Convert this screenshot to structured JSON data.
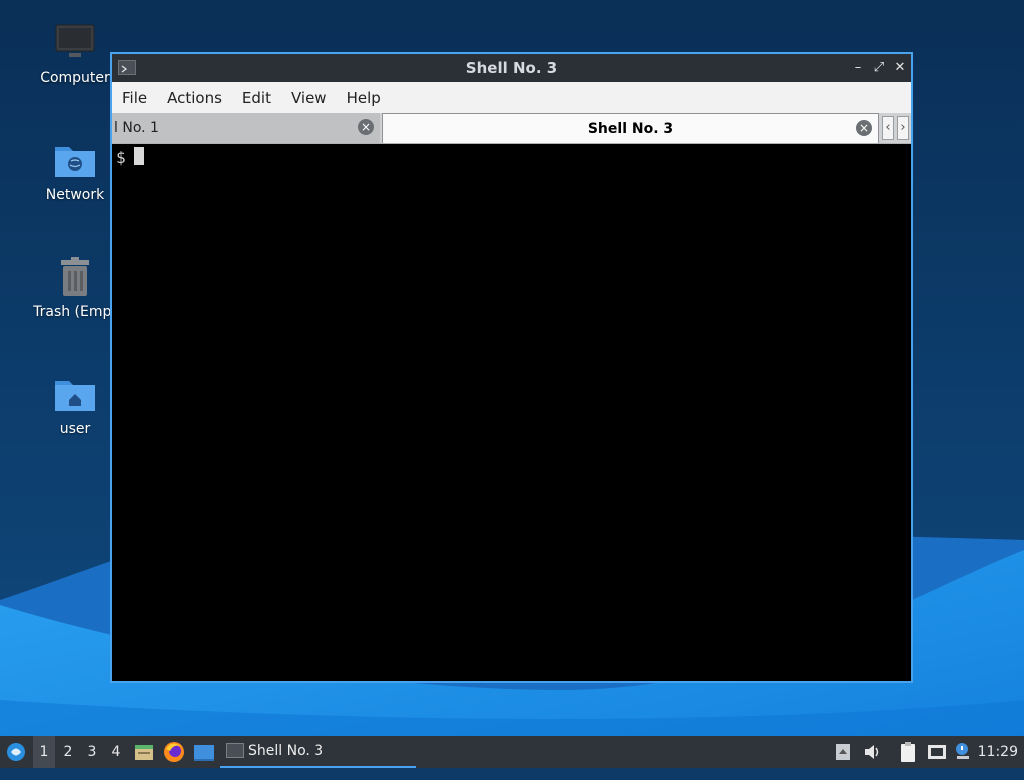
{
  "desktop": {
    "icons": [
      {
        "label": "Computer",
        "icon": "computer-icon"
      },
      {
        "label": "Network",
        "icon": "network-folder-icon"
      },
      {
        "label": "Trash (Empt",
        "icon": "trash-icon"
      },
      {
        "label": "user",
        "icon": "home-folder-icon"
      }
    ]
  },
  "window": {
    "title": "Shell No. 3",
    "controls": {
      "minimize": "–",
      "maximize": "⤢",
      "close": "✕"
    },
    "menu": [
      "File",
      "Actions",
      "Edit",
      "View",
      "Help"
    ],
    "tabs": [
      {
        "label": "l No. 1",
        "active": false
      },
      {
        "label": "Shell No. 3",
        "active": true
      }
    ],
    "tab_scroll": {
      "left": "‹",
      "right": "›"
    },
    "terminal": {
      "prompt": "$"
    }
  },
  "taskbar": {
    "workspaces": [
      "1",
      "2",
      "3",
      "4"
    ],
    "active_workspace": "1",
    "launchers": [
      "start-menu-icon",
      "file-manager-icon",
      "firefox-icon",
      "desktop-icon"
    ],
    "task": {
      "label": "Shell No. 3"
    },
    "tray": [
      "updates-icon",
      "volume-icon",
      "clipboard-icon",
      "network-icon",
      "notification-icon"
    ],
    "clock": "11:29"
  },
  "colors": {
    "accent": "#4aa3ee",
    "desktop_dark": "#0d3a66",
    "desktop_light": "#1d8fe8",
    "taskbar": "#2f343b"
  }
}
